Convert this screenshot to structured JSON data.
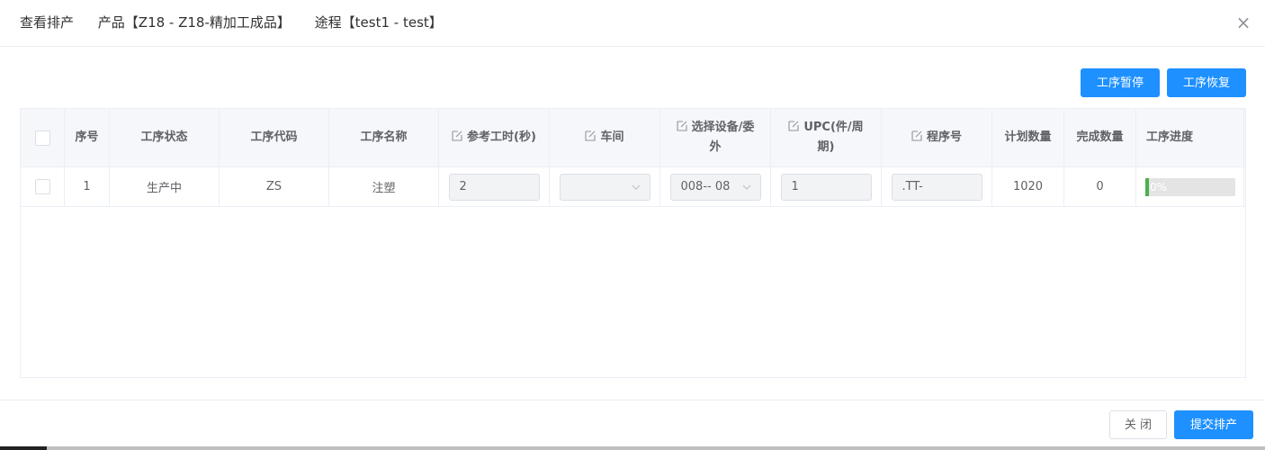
{
  "dialog": {
    "title": "查看排产",
    "product": "产品【Z18 - Z18-精加工成品】",
    "route": "途程【test1 - test】",
    "close_symbol": "×"
  },
  "toolbar": {
    "pause_label": "工序暂停",
    "resume_label": "工序恢复"
  },
  "table": {
    "headers": {
      "index": "序号",
      "status": "工序状态",
      "code": "工序代码",
      "name": "工序名称",
      "ref_time": "参考工时(秒)",
      "workshop": "车间",
      "device_a": "选择设备/委",
      "device_b": "外",
      "upc_a": "UPC(件/周",
      "upc_b": "期)",
      "program": "程序号",
      "plan_qty": "计划数量",
      "done_qty": "完成数量",
      "progress": "工序进度"
    },
    "rows": [
      {
        "index": "1",
        "status": "生产中",
        "code": "ZS",
        "name": "注塑",
        "ref_time": "2",
        "workshop": "",
        "device": "008-- 08",
        "upc": "1",
        "program": ".TT-",
        "plan_qty": "1020",
        "done_qty": "0",
        "progress_text": "0%",
        "progress_value": 0
      }
    ]
  },
  "footer": {
    "close_label": "关 闭",
    "submit_label": "提交排产"
  },
  "colors": {
    "primary": "#1e90ff",
    "progress": "#4caf50"
  }
}
